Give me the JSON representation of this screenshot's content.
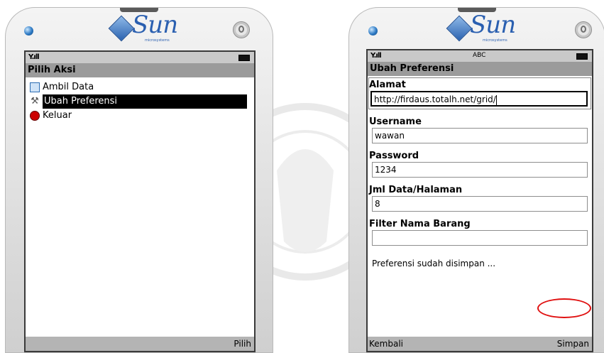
{
  "left_phone": {
    "brand": {
      "name": "Sun",
      "sub": "microsystems"
    },
    "title": "Pilih Aksi",
    "menu_items": [
      {
        "label": "Ambil Data",
        "icon": "data-icon"
      },
      {
        "label": "Ubah Preferensi",
        "icon": "tools-icon",
        "selected": true
      },
      {
        "label": "Keluar",
        "icon": "exit-icon"
      }
    ],
    "softkey_right": "Pilih"
  },
  "right_phone": {
    "brand": {
      "name": "Sun",
      "sub": "microsystems"
    },
    "input_mode": "ABC",
    "title": "Ubah Preferensi",
    "fields": [
      {
        "label": "Alamat",
        "value": "http://firdaus.totalh.net/grid/",
        "focused": true
      },
      {
        "label": "Username",
        "value": "wawan"
      },
      {
        "label": "Password",
        "value": "1234"
      },
      {
        "label": "Jml Data/Halaman",
        "value": "8"
      },
      {
        "label": "Filter Nama Barang",
        "value": ""
      }
    ],
    "message": "Preferensi sudah disimpan ...",
    "softkey_left": "Kembali",
    "softkey_right": "Simpan"
  },
  "colors": {
    "highlight_ring": "#e01010",
    "brand_blue": "#2a5fb0"
  }
}
